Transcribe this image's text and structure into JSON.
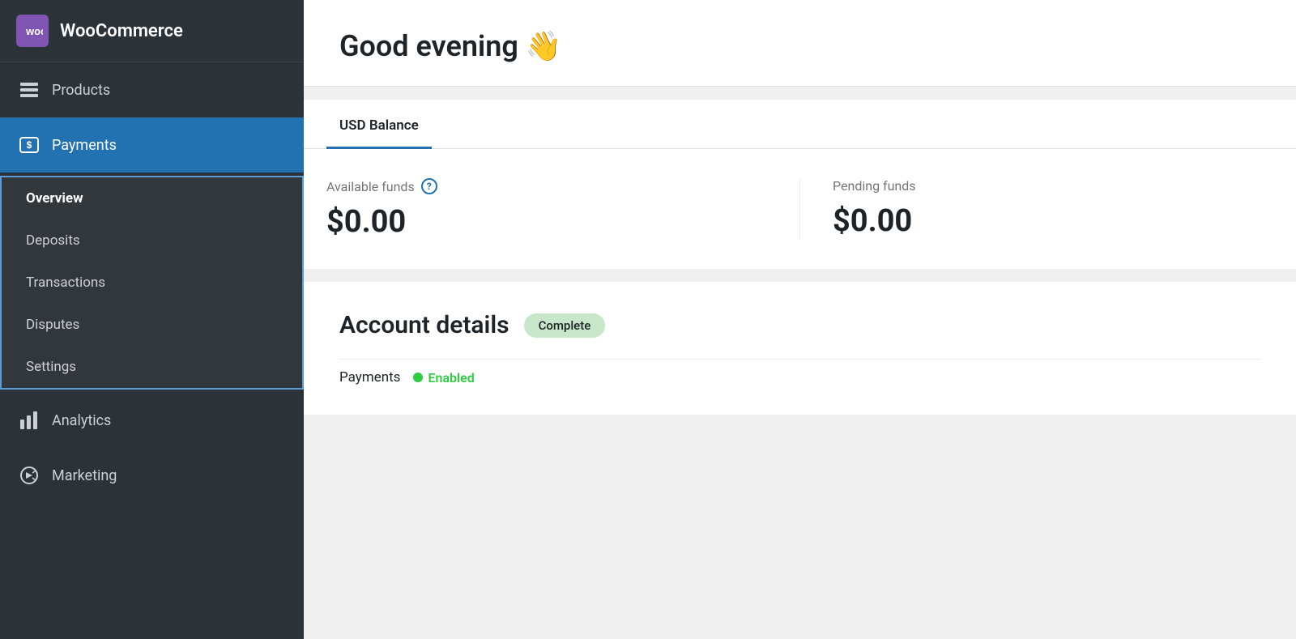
{
  "sidebar": {
    "logo": {
      "icon": "woo",
      "label": "WooCommerce"
    },
    "items": [
      {
        "id": "products",
        "label": "Products",
        "icon": "▤"
      },
      {
        "id": "payments",
        "label": "Payments",
        "icon": "$",
        "active": true,
        "submenu": [
          {
            "id": "overview",
            "label": "Overview",
            "active": true
          },
          {
            "id": "deposits",
            "label": "Deposits"
          },
          {
            "id": "transactions",
            "label": "Transactions"
          },
          {
            "id": "disputes",
            "label": "Disputes"
          },
          {
            "id": "settings",
            "label": "Settings"
          }
        ]
      },
      {
        "id": "analytics",
        "label": "Analytics",
        "icon": "📊"
      },
      {
        "id": "marketing",
        "label": "Marketing",
        "icon": "📣"
      }
    ]
  },
  "main": {
    "greeting": {
      "title": "Good evening 👋"
    },
    "balance": {
      "tab_label": "USD Balance",
      "available_funds_label": "Available funds",
      "available_funds_value": "$0.00",
      "pending_funds_label": "Pending funds",
      "pending_funds_value": "$0.00"
    },
    "account_details": {
      "title": "Account details",
      "badge": "Complete",
      "payments_label": "Payments",
      "payments_status": "Enabled"
    }
  },
  "icons": {
    "help": "?",
    "status_enabled": "●"
  }
}
